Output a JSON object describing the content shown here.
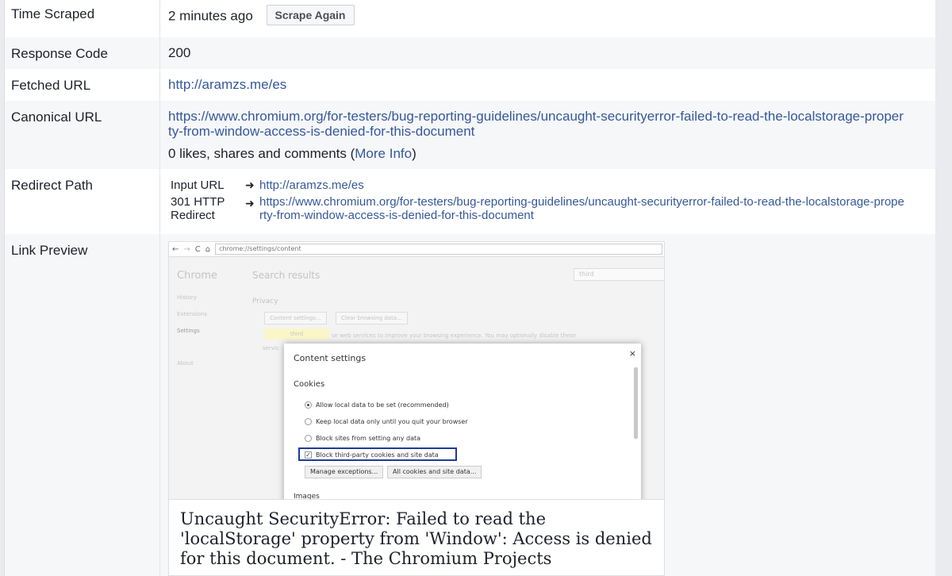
{
  "rows": {
    "time_scraped": {
      "label": "Time Scraped",
      "value": "2 minutes ago",
      "button": "Scrape Again"
    },
    "response_code": {
      "label": "Response Code",
      "value": "200"
    },
    "fetched_url": {
      "label": "Fetched URL",
      "value": "http://aramzs.me/es"
    },
    "canonical_url": {
      "label": "Canonical URL",
      "value": "https://www.chromium.org/for-testers/bug-reporting-guidelines/uncaught-securityerror-failed-to-read-the-localstorage-property-from-window-access-is-denied-for-this-document",
      "likes_prefix": "0 likes, shares and comments (",
      "more_info": "More Info",
      "likes_suffix": ")"
    },
    "redirect_path": {
      "label": "Redirect Path",
      "entries": [
        {
          "label": "Input URL",
          "url": "http://aramzs.me/es"
        },
        {
          "label": "301 HTTP Redirect",
          "url": "https://www.chromium.org/for-testers/bug-reporting-guidelines/uncaught-securityerror-failed-to-read-the-localstorage-property-from-window-access-is-denied-for-this-document"
        }
      ]
    },
    "link_preview": {
      "label": "Link Preview",
      "title": "Uncaught SecurityError: Failed to read the 'localStorage' property from 'Window': Access is denied for this document. - The Chromium Projects",
      "screenshot": {
        "address": "chrome://settings/content",
        "app": "Chrome",
        "search_heading": "Search results",
        "search_value": "third",
        "nav": [
          "History",
          "Extensions",
          "Settings",
          "About"
        ],
        "privacy": "Privacy",
        "btn_content": "Content settings...",
        "btn_clear": "Clear browsing data...",
        "highlight": "third",
        "privacy_text": "se web services to improve your browsing experience. You may optionally disable these",
        "service_fragment": "servic",
        "dialog_title": "Content settings",
        "cookies": "Cookies",
        "opt1": "Allow local data to be set (recommended)",
        "opt2": "Keep local data only until you quit your browser",
        "opt3": "Block sites from setting any data",
        "opt4": "Block third-party cookies and site data",
        "btn_exceptions": "Manage exceptions...",
        "btn_all": "All cookies and site data...",
        "images": "Images"
      }
    }
  },
  "colors": {
    "link": "#365899",
    "highlight_box": "#1f3a99"
  }
}
